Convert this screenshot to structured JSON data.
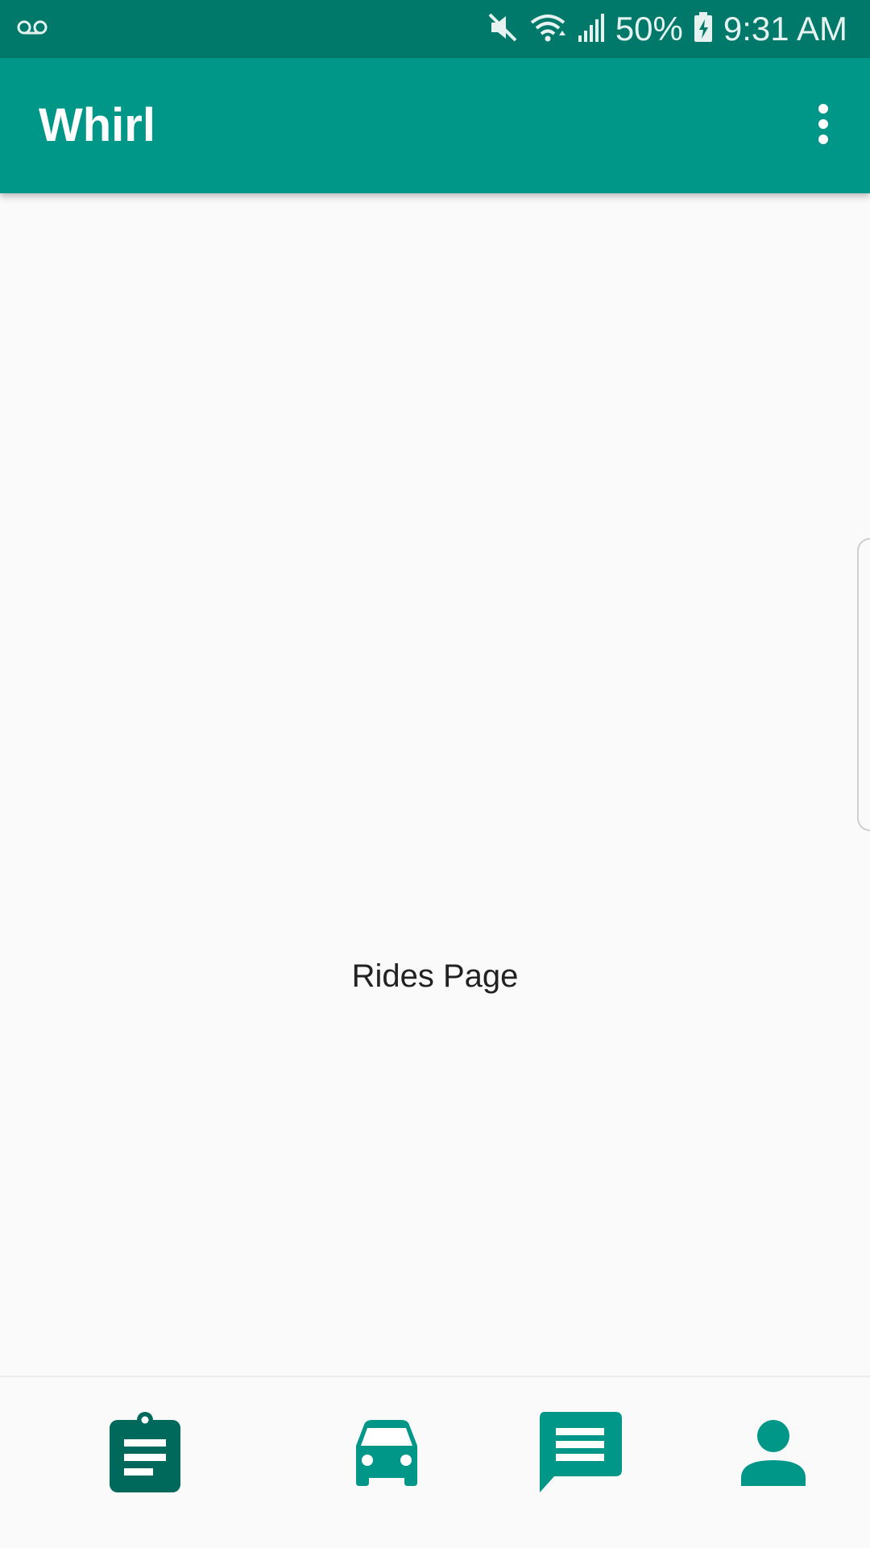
{
  "status_bar": {
    "battery": "50%",
    "time": "9:31 AM",
    "icons": [
      "voicemail-icon",
      "mute-icon",
      "wifi-icon",
      "signal-icon",
      "battery-charging-icon"
    ]
  },
  "app_bar": {
    "title": "Whirl",
    "menu_icon": "more-vert-icon"
  },
  "main": {
    "page_label": "Rides Page"
  },
  "bottom_nav": {
    "items": [
      {
        "icon": "assignment-icon",
        "selected": true
      },
      {
        "icon": "car-icon",
        "selected": false
      },
      {
        "icon": "message-icon",
        "selected": false
      },
      {
        "icon": "person-icon",
        "selected": false
      }
    ]
  },
  "colors": {
    "status_bar": "#00796b",
    "app_bar": "#009688",
    "nav_selected": "#00695c",
    "nav_default": "#009688",
    "background": "#fafafa"
  }
}
